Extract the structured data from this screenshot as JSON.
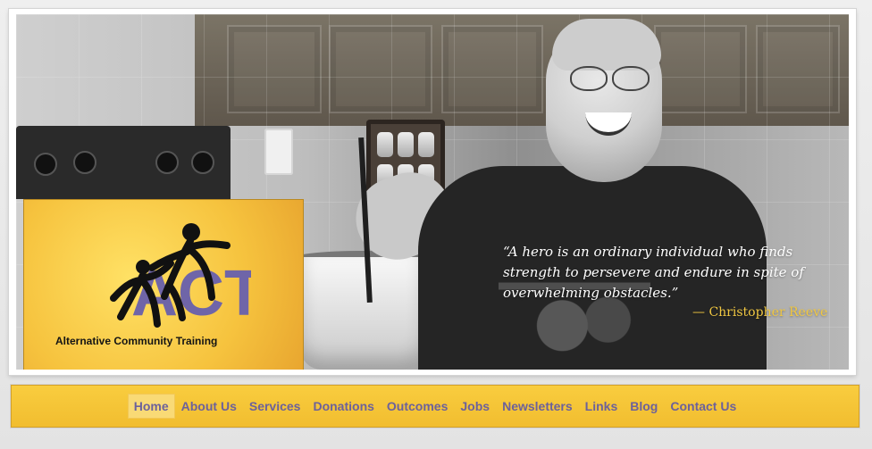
{
  "logo": {
    "mark_text": "ACT",
    "subtitle": "Alternative Community Training"
  },
  "hero": {
    "quote_line_1": "“A hero is an ordinary individual who finds",
    "quote_line_2": "strength to persevere and endure in spite of",
    "quote_line_3": "overwhelming obstacles.”",
    "author": "— Christopher Reeve"
  },
  "nav": {
    "items": [
      {
        "label": "Home",
        "active": true
      },
      {
        "label": "About Us"
      },
      {
        "label": "Services"
      },
      {
        "label": "Donations"
      },
      {
        "label": "Outcomes"
      },
      {
        "label": "Jobs"
      },
      {
        "label": "Newsletters"
      },
      {
        "label": "Links"
      },
      {
        "label": "Blog"
      },
      {
        "label": "Contact Us"
      }
    ]
  },
  "colors": {
    "brand_yellow": "#f6c33e",
    "nav_text": "#6c619b",
    "logo_purple": "#6f65a8",
    "quote_text": "#ffffff",
    "author_text": "#f1c842"
  }
}
